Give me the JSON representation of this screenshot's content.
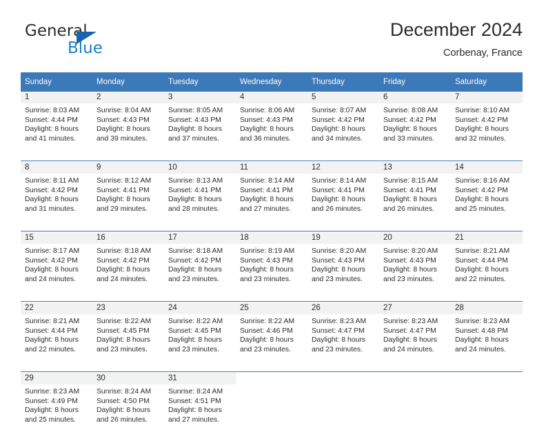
{
  "brand": {
    "name_part1": "General",
    "name_part2": "Blue",
    "triangle_color": "#1565a8",
    "blue_color": "#1a7fc1"
  },
  "header": {
    "title": "December 2024",
    "subtitle": "Corbenay, France"
  },
  "theme": {
    "header_blue": "#3b79b8",
    "daynum_band": "#f2f2f2",
    "text": "#2b2b2b"
  },
  "columns": [
    "Sunday",
    "Monday",
    "Tuesday",
    "Wednesday",
    "Thursday",
    "Friday",
    "Saturday"
  ],
  "weeks": [
    [
      {
        "day": "1",
        "sunrise": "Sunrise: 8:03 AM",
        "sunset": "Sunset: 4:44 PM",
        "daylight1": "Daylight: 8 hours",
        "daylight2": "and 41 minutes."
      },
      {
        "day": "2",
        "sunrise": "Sunrise: 8:04 AM",
        "sunset": "Sunset: 4:43 PM",
        "daylight1": "Daylight: 8 hours",
        "daylight2": "and 39 minutes."
      },
      {
        "day": "3",
        "sunrise": "Sunrise: 8:05 AM",
        "sunset": "Sunset: 4:43 PM",
        "daylight1": "Daylight: 8 hours",
        "daylight2": "and 37 minutes."
      },
      {
        "day": "4",
        "sunrise": "Sunrise: 8:06 AM",
        "sunset": "Sunset: 4:43 PM",
        "daylight1": "Daylight: 8 hours",
        "daylight2": "and 36 minutes."
      },
      {
        "day": "5",
        "sunrise": "Sunrise: 8:07 AM",
        "sunset": "Sunset: 4:42 PM",
        "daylight1": "Daylight: 8 hours",
        "daylight2": "and 34 minutes."
      },
      {
        "day": "6",
        "sunrise": "Sunrise: 8:08 AM",
        "sunset": "Sunset: 4:42 PM",
        "daylight1": "Daylight: 8 hours",
        "daylight2": "and 33 minutes."
      },
      {
        "day": "7",
        "sunrise": "Sunrise: 8:10 AM",
        "sunset": "Sunset: 4:42 PM",
        "daylight1": "Daylight: 8 hours",
        "daylight2": "and 32 minutes."
      }
    ],
    [
      {
        "day": "8",
        "sunrise": "Sunrise: 8:11 AM",
        "sunset": "Sunset: 4:42 PM",
        "daylight1": "Daylight: 8 hours",
        "daylight2": "and 31 minutes."
      },
      {
        "day": "9",
        "sunrise": "Sunrise: 8:12 AM",
        "sunset": "Sunset: 4:41 PM",
        "daylight1": "Daylight: 8 hours",
        "daylight2": "and 29 minutes."
      },
      {
        "day": "10",
        "sunrise": "Sunrise: 8:13 AM",
        "sunset": "Sunset: 4:41 PM",
        "daylight1": "Daylight: 8 hours",
        "daylight2": "and 28 minutes."
      },
      {
        "day": "11",
        "sunrise": "Sunrise: 8:14 AM",
        "sunset": "Sunset: 4:41 PM",
        "daylight1": "Daylight: 8 hours",
        "daylight2": "and 27 minutes."
      },
      {
        "day": "12",
        "sunrise": "Sunrise: 8:14 AM",
        "sunset": "Sunset: 4:41 PM",
        "daylight1": "Daylight: 8 hours",
        "daylight2": "and 26 minutes."
      },
      {
        "day": "13",
        "sunrise": "Sunrise: 8:15 AM",
        "sunset": "Sunset: 4:41 PM",
        "daylight1": "Daylight: 8 hours",
        "daylight2": "and 26 minutes."
      },
      {
        "day": "14",
        "sunrise": "Sunrise: 8:16 AM",
        "sunset": "Sunset: 4:42 PM",
        "daylight1": "Daylight: 8 hours",
        "daylight2": "and 25 minutes."
      }
    ],
    [
      {
        "day": "15",
        "sunrise": "Sunrise: 8:17 AM",
        "sunset": "Sunset: 4:42 PM",
        "daylight1": "Daylight: 8 hours",
        "daylight2": "and 24 minutes."
      },
      {
        "day": "16",
        "sunrise": "Sunrise: 8:18 AM",
        "sunset": "Sunset: 4:42 PM",
        "daylight1": "Daylight: 8 hours",
        "daylight2": "and 24 minutes."
      },
      {
        "day": "17",
        "sunrise": "Sunrise: 8:18 AM",
        "sunset": "Sunset: 4:42 PM",
        "daylight1": "Daylight: 8 hours",
        "daylight2": "and 23 minutes."
      },
      {
        "day": "18",
        "sunrise": "Sunrise: 8:19 AM",
        "sunset": "Sunset: 4:43 PM",
        "daylight1": "Daylight: 8 hours",
        "daylight2": "and 23 minutes."
      },
      {
        "day": "19",
        "sunrise": "Sunrise: 8:20 AM",
        "sunset": "Sunset: 4:43 PM",
        "daylight1": "Daylight: 8 hours",
        "daylight2": "and 23 minutes."
      },
      {
        "day": "20",
        "sunrise": "Sunrise: 8:20 AM",
        "sunset": "Sunset: 4:43 PM",
        "daylight1": "Daylight: 8 hours",
        "daylight2": "and 23 minutes."
      },
      {
        "day": "21",
        "sunrise": "Sunrise: 8:21 AM",
        "sunset": "Sunset: 4:44 PM",
        "daylight1": "Daylight: 8 hours",
        "daylight2": "and 22 minutes."
      }
    ],
    [
      {
        "day": "22",
        "sunrise": "Sunrise: 8:21 AM",
        "sunset": "Sunset: 4:44 PM",
        "daylight1": "Daylight: 8 hours",
        "daylight2": "and 22 minutes."
      },
      {
        "day": "23",
        "sunrise": "Sunrise: 8:22 AM",
        "sunset": "Sunset: 4:45 PM",
        "daylight1": "Daylight: 8 hours",
        "daylight2": "and 23 minutes."
      },
      {
        "day": "24",
        "sunrise": "Sunrise: 8:22 AM",
        "sunset": "Sunset: 4:45 PM",
        "daylight1": "Daylight: 8 hours",
        "daylight2": "and 23 minutes."
      },
      {
        "day": "25",
        "sunrise": "Sunrise: 8:22 AM",
        "sunset": "Sunset: 4:46 PM",
        "daylight1": "Daylight: 8 hours",
        "daylight2": "and 23 minutes."
      },
      {
        "day": "26",
        "sunrise": "Sunrise: 8:23 AM",
        "sunset": "Sunset: 4:47 PM",
        "daylight1": "Daylight: 8 hours",
        "daylight2": "and 23 minutes."
      },
      {
        "day": "27",
        "sunrise": "Sunrise: 8:23 AM",
        "sunset": "Sunset: 4:47 PM",
        "daylight1": "Daylight: 8 hours",
        "daylight2": "and 24 minutes."
      },
      {
        "day": "28",
        "sunrise": "Sunrise: 8:23 AM",
        "sunset": "Sunset: 4:48 PM",
        "daylight1": "Daylight: 8 hours",
        "daylight2": "and 24 minutes."
      }
    ],
    [
      {
        "day": "29",
        "sunrise": "Sunrise: 8:23 AM",
        "sunset": "Sunset: 4:49 PM",
        "daylight1": "Daylight: 8 hours",
        "daylight2": "and 25 minutes."
      },
      {
        "day": "30",
        "sunrise": "Sunrise: 8:24 AM",
        "sunset": "Sunset: 4:50 PM",
        "daylight1": "Daylight: 8 hours",
        "daylight2": "and 26 minutes."
      },
      {
        "day": "31",
        "sunrise": "Sunrise: 8:24 AM",
        "sunset": "Sunset: 4:51 PM",
        "daylight1": "Daylight: 8 hours",
        "daylight2": "and 27 minutes."
      },
      {
        "day": "",
        "sunrise": "",
        "sunset": "",
        "daylight1": "",
        "daylight2": ""
      },
      {
        "day": "",
        "sunrise": "",
        "sunset": "",
        "daylight1": "",
        "daylight2": ""
      },
      {
        "day": "",
        "sunrise": "",
        "sunset": "",
        "daylight1": "",
        "daylight2": ""
      },
      {
        "day": "",
        "sunrise": "",
        "sunset": "",
        "daylight1": "",
        "daylight2": ""
      }
    ]
  ]
}
